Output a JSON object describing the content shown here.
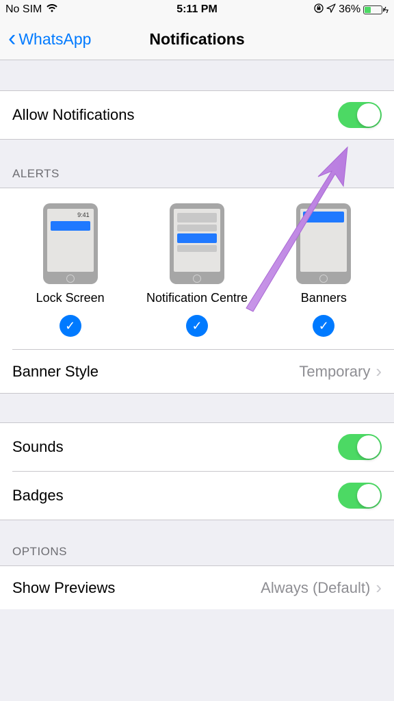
{
  "statusBar": {
    "carrier": "No SIM",
    "time": "5:11 PM",
    "battery": "36%"
  },
  "nav": {
    "back": "WhatsApp",
    "title": "Notifications"
  },
  "allowNotifications": {
    "label": "Allow Notifications",
    "on": true
  },
  "alertsHeader": "ALERTS",
  "alertOptions": [
    {
      "label": "Lock Screen",
      "checked": true,
      "lockTime": "9:41"
    },
    {
      "label": "Notification Centre",
      "checked": true
    },
    {
      "label": "Banners",
      "checked": true
    }
  ],
  "bannerStyle": {
    "label": "Banner Style",
    "value": "Temporary"
  },
  "sounds": {
    "label": "Sounds",
    "on": true
  },
  "badges": {
    "label": "Badges",
    "on": true
  },
  "optionsHeader": "OPTIONS",
  "showPreviews": {
    "label": "Show Previews",
    "value": "Always (Default)"
  }
}
